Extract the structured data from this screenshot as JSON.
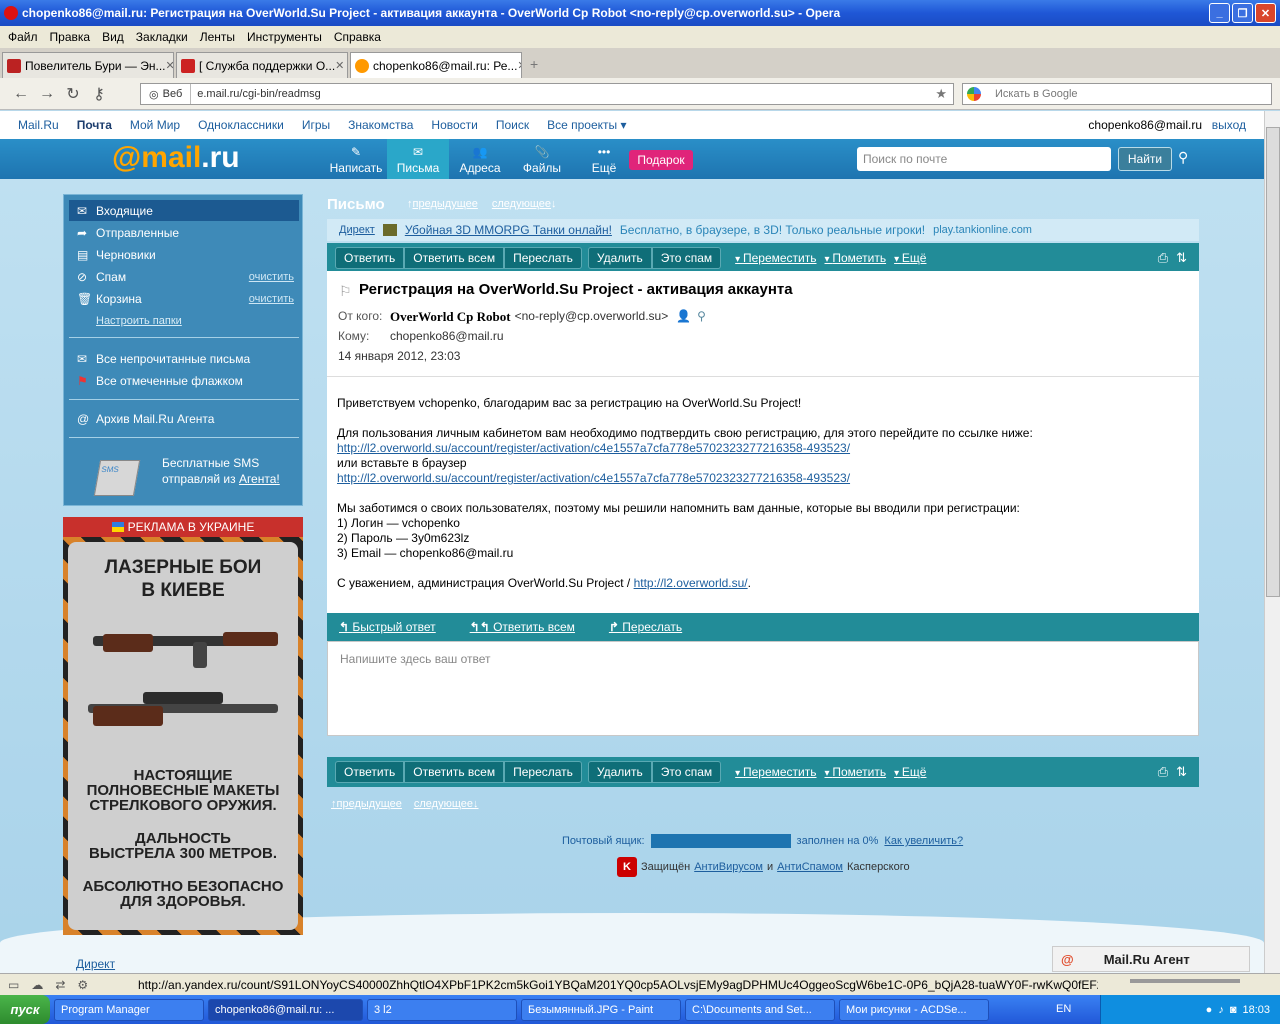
{
  "window": {
    "title": "chopenko86@mail.ru: Регистрация на OverWorld.Su Project - активация аккаунта - OverWorld Cp Robot <no-reply@cp.overworld.su> - Opera"
  },
  "menu": [
    "Файл",
    "Правка",
    "Вид",
    "Закладки",
    "Ленты",
    "Инструменты",
    "Справка"
  ],
  "tabs": [
    {
      "label": "Повелитель Бури — Эн..."
    },
    {
      "label": "[ Служба поддержки О..."
    },
    {
      "label": "chopenko86@mail.ru: Ре..."
    }
  ],
  "address": {
    "web": "Веб",
    "url": "e.mail.ru/cgi-bin/readmsg",
    "search_placeholder": "Искать в Google"
  },
  "portal": {
    "links": [
      "Mail.Ru",
      "Почта",
      "Мой Мир",
      "Одноклассники",
      "Игры",
      "Знакомства",
      "Новости",
      "Поиск",
      "Все проекты ▾"
    ],
    "account": "chopenko86@mail.ru",
    "logout": "выход"
  },
  "header": {
    "logo_at": "@",
    "logo_mail": "mail",
    "logo_ru": ".ru",
    "nav": [
      {
        "label": "Написать",
        "icon": "pencil-icon"
      },
      {
        "label": "Письма",
        "icon": "envelope-icon"
      },
      {
        "label": "Адреса",
        "icon": "contacts-icon"
      },
      {
        "label": "Файлы",
        "icon": "paperclip-icon"
      },
      {
        "label": "Ещё",
        "icon": "more-icon"
      }
    ],
    "gift": "Подарок",
    "search_placeholder": "Поиск по почте",
    "find": "Найти"
  },
  "sidebar": {
    "folders": [
      {
        "label": "Входящие"
      },
      {
        "label": "Отправленные"
      },
      {
        "label": "Черновики"
      },
      {
        "label": "Спам",
        "clear": "очистить"
      },
      {
        "label": "Корзина",
        "clear": "очистить"
      }
    ],
    "setup": "Настроить папки",
    "unread": "Все непрочитанные письма",
    "flagged": "Все отмеченные флажком",
    "archive": "Архив Mail.Ru Агента",
    "sms_line1": "Бесплатные SMS",
    "sms_line2": "отправляй из ",
    "sms_link": "Агента!",
    "sms_badge": "SMS"
  },
  "ad": {
    "header": "РЕКЛАМА В УКРАИНЕ",
    "title1": "ЛАЗЕРНЫЕ БОИ",
    "title2": "В КИЕВЕ",
    "l1": "НАСТОЯЩИЕ",
    "l2": "ПОЛНОВЕСНЫЕ МАКЕТЫ",
    "l3": "СТРЕЛКОВОГО ОРУЖИЯ.",
    "l4": "ДАЛЬНОСТЬ",
    "l5": "ВЫСТРЕЛА 300 МЕТРОВ.",
    "l6": "АБСОЛЮТНО БЕЗОПАСНО",
    "l7": "ДЛЯ ЗДОРОВЬЯ.",
    "direct": "Директ"
  },
  "letter": {
    "section": "Письмо",
    "prev": "предыдущее",
    "next": "следующее",
    "promo_direct": "Директ",
    "promo_link": "Убойная 3D MMORPG Танки онлайн!",
    "promo_text": "Бесплатно, в браузере, в 3D! Только реальные игроки!",
    "promo_url": "play.tankionline.com",
    "actions": [
      "Ответить",
      "Ответить всем",
      "Переслать",
      "Удалить",
      "Это спам"
    ],
    "selects": [
      "Переместить",
      "Пометить",
      "Ещё"
    ],
    "subject": "Регистрация на OverWorld.Su Project - активация аккаунта",
    "from_label": "От кого:",
    "from_name": "OverWorld Cp Robot",
    "from_email": "<no-reply@cp.overworld.su>",
    "to_label": "Кому:",
    "to": "chopenko86@mail.ru",
    "date": "14 января 2012, 23:03",
    "body": {
      "greeting": "Приветствуем vchopenko, благодарим вас за регистрацию на OverWorld.Su Project!",
      "p2": "Для пользования личным кабинетом вам необходимо подтвердить свою регистрацию, для этого перейдите по ссылке ниже:",
      "link": "http://l2.overworld.su/account/register/activation/c4e1557a7cfa778e5702323277216358-493523/",
      "or": "или вставьте в браузер",
      "p3": "Мы заботимся о своих пользователях, поэтому мы решили напомнить вам данные, которые вы вводили при регистрации:",
      "login": "1) Логин — vchopenko",
      "password": "2) Пароль — 3y0m623lz",
      "email": "3) Email — chopenko86@mail.ru",
      "sign": "С уважением, администрация OverWorld.Su Project / ",
      "sign_link": "http://l2.overworld.su/",
      "sign_end": "."
    },
    "quick": [
      "Быстрый ответ",
      "Ответить всем",
      "Переслать"
    ],
    "reply_placeholder": "Напишите здесь ваш ответ",
    "quota_label": "Почтовый ящик:",
    "quota_fill": 0,
    "quota_text": "заполнен на 0%",
    "quota_link": "Как увеличить?",
    "kas_pre": "Защищён",
    "kas_av": "АнтиВирусом",
    "kas_and": "и",
    "kas_as": "АнтиСпамом",
    "kas_post": "Касперского",
    "kas_logo": "K"
  },
  "agent": {
    "at": "@",
    "label": "Mail.Ru Агент"
  },
  "status": {
    "url": "http://an.yandex.ru/count/S91LONYoyCS40000ZhhQtlO4XPbF1PK2cm5kGoi1YBQaM201YQ0cp5AOLvsjEMy9agDPHMUc4OggeoScgW6be1C-0P6_bQjA28-tuaWY0F-rwKwQ0fEF29apGeoGuWIWaE8..."
  },
  "taskbar": {
    "start": "пуск",
    "tasks": [
      "Program Manager",
      "chopenko86@mail.ru: ...",
      "3 l2",
      "Безымянный.JPG - Paint",
      "C:\\Documents and Set...",
      "Мои рисунки - ACDSe..."
    ],
    "lang": "EN",
    "time": "18:03"
  }
}
